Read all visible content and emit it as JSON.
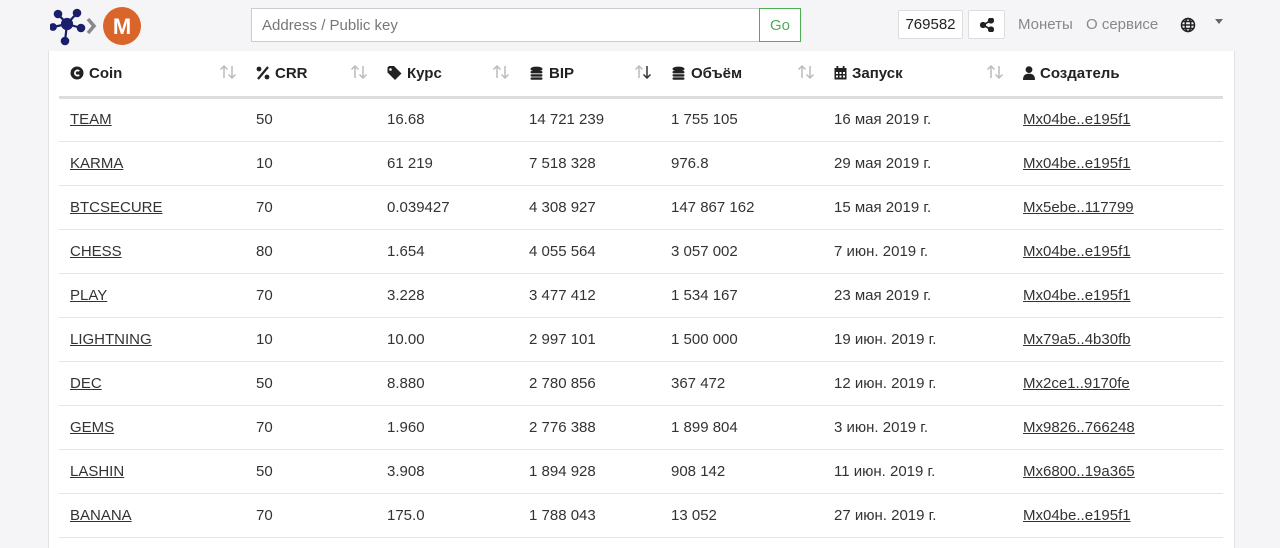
{
  "header": {
    "search_placeholder": "Address / Public key",
    "go_label": "Go",
    "block_number": "769582",
    "nav_coins": "Монеты",
    "nav_about": "О сервисе",
    "logo_letter": "M"
  },
  "colors": {
    "accent_green": "#4caf50",
    "logo_orange": "#d9652b",
    "logo_navy": "#1a1f6b"
  },
  "table": {
    "columns": [
      {
        "label": "Coin",
        "icon": "coin-icon"
      },
      {
        "label": "CRR",
        "icon": "percent-icon"
      },
      {
        "label": "Курс",
        "icon": "tag-icon"
      },
      {
        "label": "BIP",
        "icon": "coins-stack-icon"
      },
      {
        "label": "Объём",
        "icon": "coins-stack-icon"
      },
      {
        "label": "Запуск",
        "icon": "calendar-icon"
      },
      {
        "label": "Создатель",
        "icon": "user-icon"
      }
    ],
    "rows": [
      {
        "coin": "TEAM",
        "crr": "50",
        "rate": "16.68",
        "bip": "14 721 239",
        "volume": "1 755 105",
        "launch": "16 мая 2019 г.",
        "creator": "Mx04be..e195f1"
      },
      {
        "coin": "KARMA",
        "crr": "10",
        "rate": "61 219",
        "bip": "7 518 328",
        "volume": "976.8",
        "launch": "29 мая 2019 г.",
        "creator": "Mx04be..e195f1"
      },
      {
        "coin": "BTCSECURE",
        "crr": "70",
        "rate": "0.039427",
        "bip": "4 308 927",
        "volume": "147 867 162",
        "launch": "15 мая 2019 г.",
        "creator": "Mx5ebe..117799"
      },
      {
        "coin": "CHESS",
        "crr": "80",
        "rate": "1.654",
        "bip": "4 055 564",
        "volume": "3 057 002",
        "launch": "7 июн. 2019 г.",
        "creator": "Mx04be..e195f1"
      },
      {
        "coin": "PLAY",
        "crr": "70",
        "rate": "3.228",
        "bip": "3 477 412",
        "volume": "1 534 167",
        "launch": "23 мая 2019 г.",
        "creator": "Mx04be..e195f1"
      },
      {
        "coin": "LIGHTNING",
        "crr": "10",
        "rate": "10.00",
        "bip": "2 997 101",
        "volume": "1 500 000",
        "launch": "19 июн. 2019 г.",
        "creator": "Mx79a5..4b30fb"
      },
      {
        "coin": "DEC",
        "crr": "50",
        "rate": "8.880",
        "bip": "2 780 856",
        "volume": "367 472",
        "launch": "12 июн. 2019 г.",
        "creator": "Mx2ce1..9170fe"
      },
      {
        "coin": "GEMS",
        "crr": "70",
        "rate": "1.960",
        "bip": "2 776 388",
        "volume": "1 899 804",
        "launch": "3 июн. 2019 г.",
        "creator": "Mx9826..766248"
      },
      {
        "coin": "LASHIN",
        "crr": "50",
        "rate": "3.908",
        "bip": "1 894 928",
        "volume": "908 142",
        "launch": "11 июн. 2019 г.",
        "creator": "Mx6800..19a365"
      },
      {
        "coin": "BANANA",
        "crr": "70",
        "rate": "175.0",
        "bip": "1 788 043",
        "volume": "13 052",
        "launch": "27 июн. 2019 г.",
        "creator": "Mx04be..e195f1"
      }
    ]
  }
}
